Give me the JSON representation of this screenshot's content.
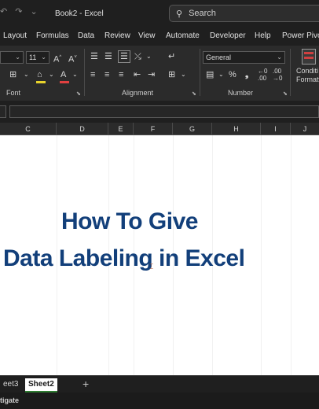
{
  "window": {
    "title": "Book2  -  Excel",
    "search_placeholder": "Search"
  },
  "ribbon_tabs": [
    "Layout",
    "Formulas",
    "Data",
    "Review",
    "View",
    "Automate",
    "Developer",
    "Help",
    "Power Pivot"
  ],
  "ribbon": {
    "font_size": "11",
    "number_format": "General",
    "groups": {
      "font": "Font",
      "alignment": "Alignment",
      "number": "Number"
    },
    "conditional_line1": "Conditi",
    "conditional_line2": "Formatti"
  },
  "columns": [
    "C",
    "D",
    "E",
    "F",
    "G",
    "H",
    "I",
    "J"
  ],
  "sheet_content": {
    "line1": "How To Give",
    "line2": "Data Labeling in Excel",
    "text_color": "#123f7a"
  },
  "sheet_tabs": [
    {
      "label": "eet3",
      "active": false
    },
    {
      "label": "Sheet2",
      "active": true
    }
  ],
  "add_sheet": "+",
  "status": {
    "text": "tigate"
  }
}
